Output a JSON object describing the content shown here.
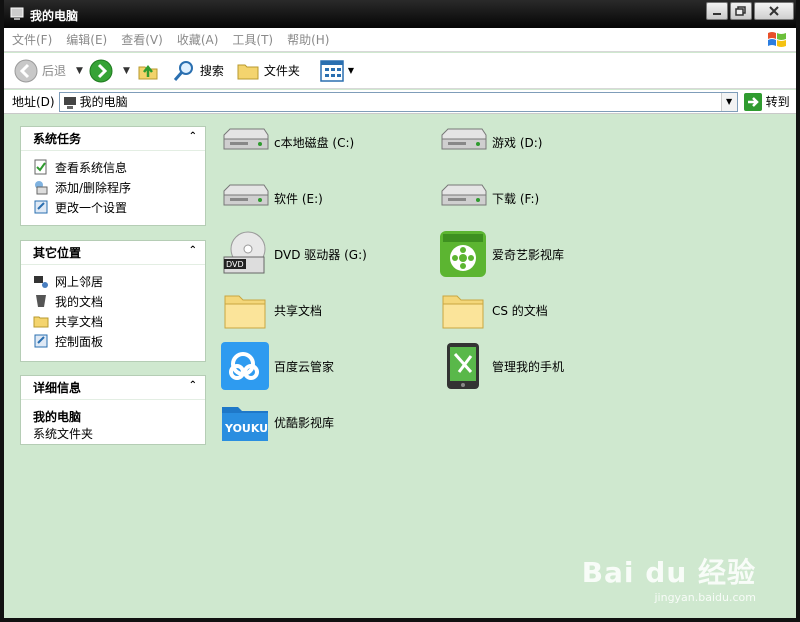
{
  "window": {
    "title": "我的电脑"
  },
  "menubar": {
    "items": [
      "文件(F)",
      "编辑(E)",
      "查看(V)",
      "收藏(A)",
      "工具(T)",
      "帮助(H)"
    ]
  },
  "toolbar": {
    "back": "后退",
    "search": "搜索",
    "folders": "文件夹"
  },
  "address": {
    "label": "地址(D)",
    "value": "我的电脑",
    "go": "转到"
  },
  "panels": {
    "system_tasks": {
      "title": "系统任务",
      "items": [
        "查看系统信息",
        "添加/删除程序",
        "更改一个设置"
      ]
    },
    "other_places": {
      "title": "其它位置",
      "items": [
        "网上邻居",
        "我的文档",
        "共享文档",
        "控制面板"
      ]
    },
    "details": {
      "title": "详细信息",
      "name": "我的电脑",
      "desc": "系统文件夹"
    }
  },
  "items": [
    {
      "label": "c本地磁盘 (C:)",
      "icon": "hard-drive-icon"
    },
    {
      "label": "游戏 (D:)",
      "icon": "hard-drive-icon"
    },
    {
      "label": "软件 (E:)",
      "icon": "hard-drive-icon"
    },
    {
      "label": "下载 (F:)",
      "icon": "hard-drive-icon"
    },
    {
      "label": "DVD 驱动器 (G:)",
      "icon": "dvd-drive-icon"
    },
    {
      "label": "爱奇艺影视库",
      "icon": "iqiyi-icon"
    },
    {
      "label": "共享文档",
      "icon": "folder-icon"
    },
    {
      "label": "CS 的文档",
      "icon": "folder-icon"
    },
    {
      "label": "百度云管家",
      "icon": "baidu-cloud-icon"
    },
    {
      "label": "管理我的手机",
      "icon": "phone-manager-icon"
    },
    {
      "label": "优酷影视库",
      "icon": "youku-icon",
      "icon_text": "YOUKU"
    }
  ],
  "watermark": {
    "main": "Bai du 经验",
    "sub": "jingyan.baidu.com"
  },
  "colors": {
    "background": "#cfe8cf",
    "titlebar": "#111111",
    "accent_green": "#2f9b2f"
  }
}
